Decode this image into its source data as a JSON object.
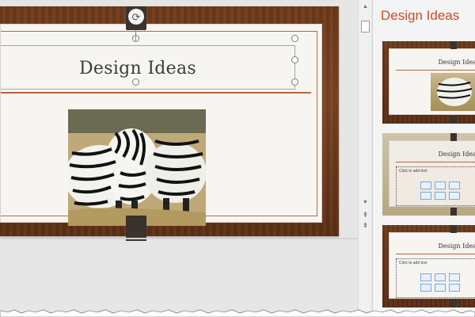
{
  "slide": {
    "title": "Design Ideas",
    "image": "zebra-photo"
  },
  "pane": {
    "title": "Design Ideas",
    "thumbnails": [
      {
        "title": "Design Ideas",
        "variant": "photo-right",
        "selected": true
      },
      {
        "title": "Design Ideas",
        "variant": "content-placeholder-photo-bg",
        "placeholder": "Click to add text",
        "selected": false
      },
      {
        "title": "Design Ideas",
        "variant": "content-placeholder",
        "placeholder": "Click to add text",
        "selected": false
      }
    ]
  },
  "scrollbar": {
    "up_icon": "scroll-up-arrow-icon",
    "down_icon": "scroll-down-arrow-icon",
    "prev_slide_icon": "previous-slide-icon",
    "next_slide_icon": "next-slide-icon"
  },
  "colors": {
    "accent": "#d24726",
    "wood": "#6e3a1b",
    "rule": "#b7643a",
    "selection": "#c0392b"
  }
}
